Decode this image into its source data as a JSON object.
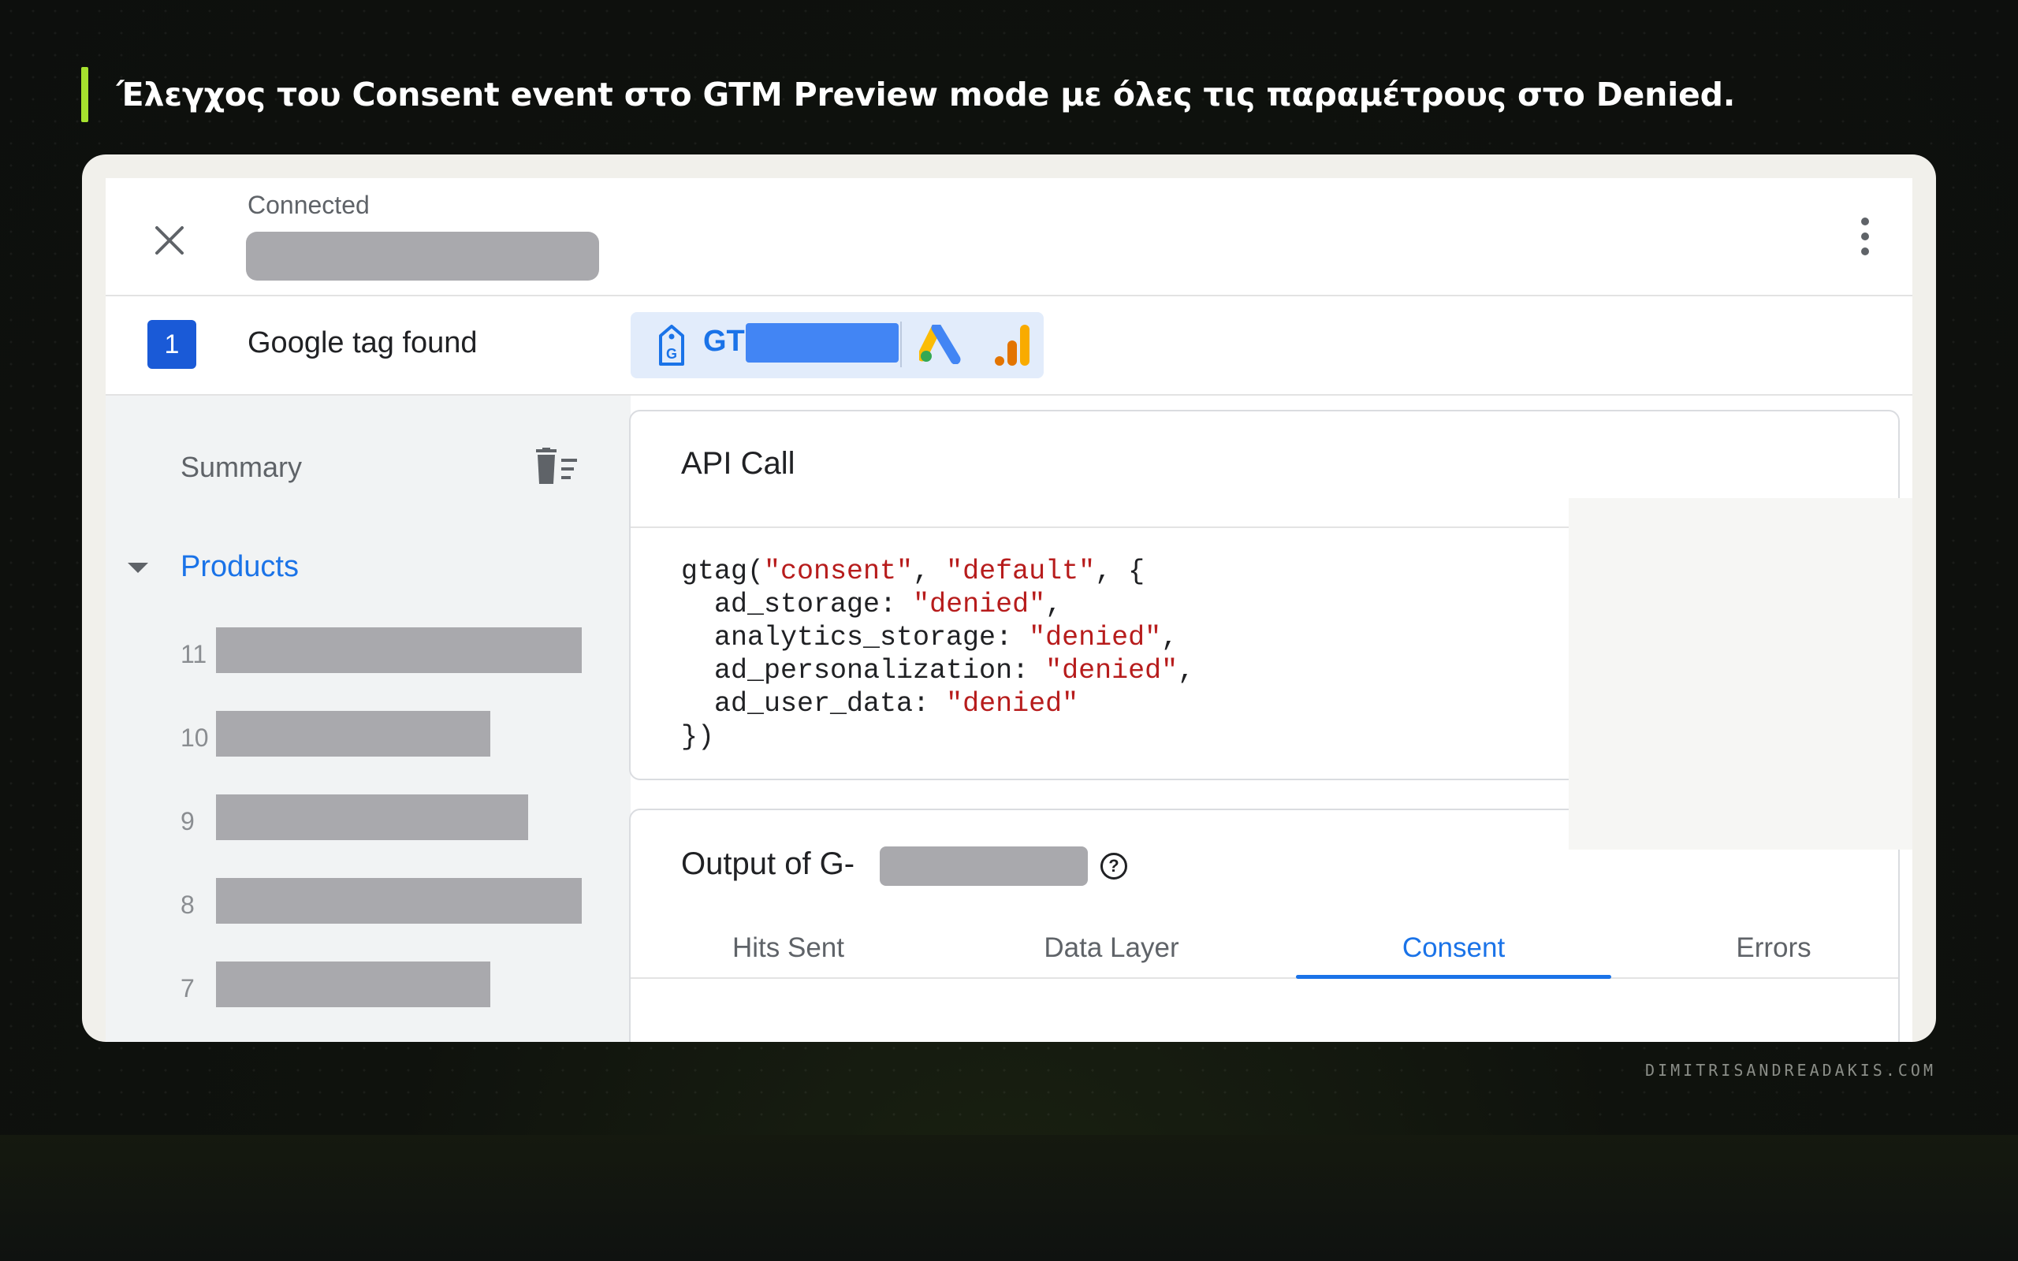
{
  "heading": "Έλεγχος του Consent event στο GTM Preview mode με όλες τις παραμέτρους στο Denied.",
  "colors": {
    "accent": "#a6e22e",
    "link": "#1a73e8",
    "string": "#b71c1c"
  },
  "topbar": {
    "status": "Connected",
    "close_icon": "close-icon",
    "menu_icon": "more-vert-icon"
  },
  "tag_row": {
    "count": "1",
    "label": "Google tag found",
    "tag_prefix": "GT"
  },
  "sidebar": {
    "summary": "Summary",
    "section": "Products",
    "events": [
      {
        "num": "11"
      },
      {
        "num": "10"
      },
      {
        "num": "9"
      },
      {
        "num": "8"
      },
      {
        "num": "7"
      }
    ]
  },
  "api_panel": {
    "title": "API Call",
    "code": {
      "fn_open": "gtag(",
      "arg1": "\"consent\"",
      "sep1": ", ",
      "arg2": "\"default\"",
      "sep2": ", {",
      "params": [
        {
          "key": "  ad_storage: ",
          "value": "\"denied\"",
          "tail": ","
        },
        {
          "key": "  analytics_storage: ",
          "value": "\"denied\"",
          "tail": ","
        },
        {
          "key": "  ad_personalization: ",
          "value": "\"denied\"",
          "tail": ","
        },
        {
          "key": "  ad_user_data: ",
          "value": "\"denied\"",
          "tail": ""
        }
      ],
      "close": "})"
    }
  },
  "output_panel": {
    "title_prefix": "Output of G-",
    "tabs": [
      {
        "label": "Hits Sent"
      },
      {
        "label": "Data Layer"
      },
      {
        "label": "Consent",
        "active": true
      },
      {
        "label": "Errors"
      }
    ]
  },
  "footer": "DIMITRISANDREADAKIS.COM"
}
